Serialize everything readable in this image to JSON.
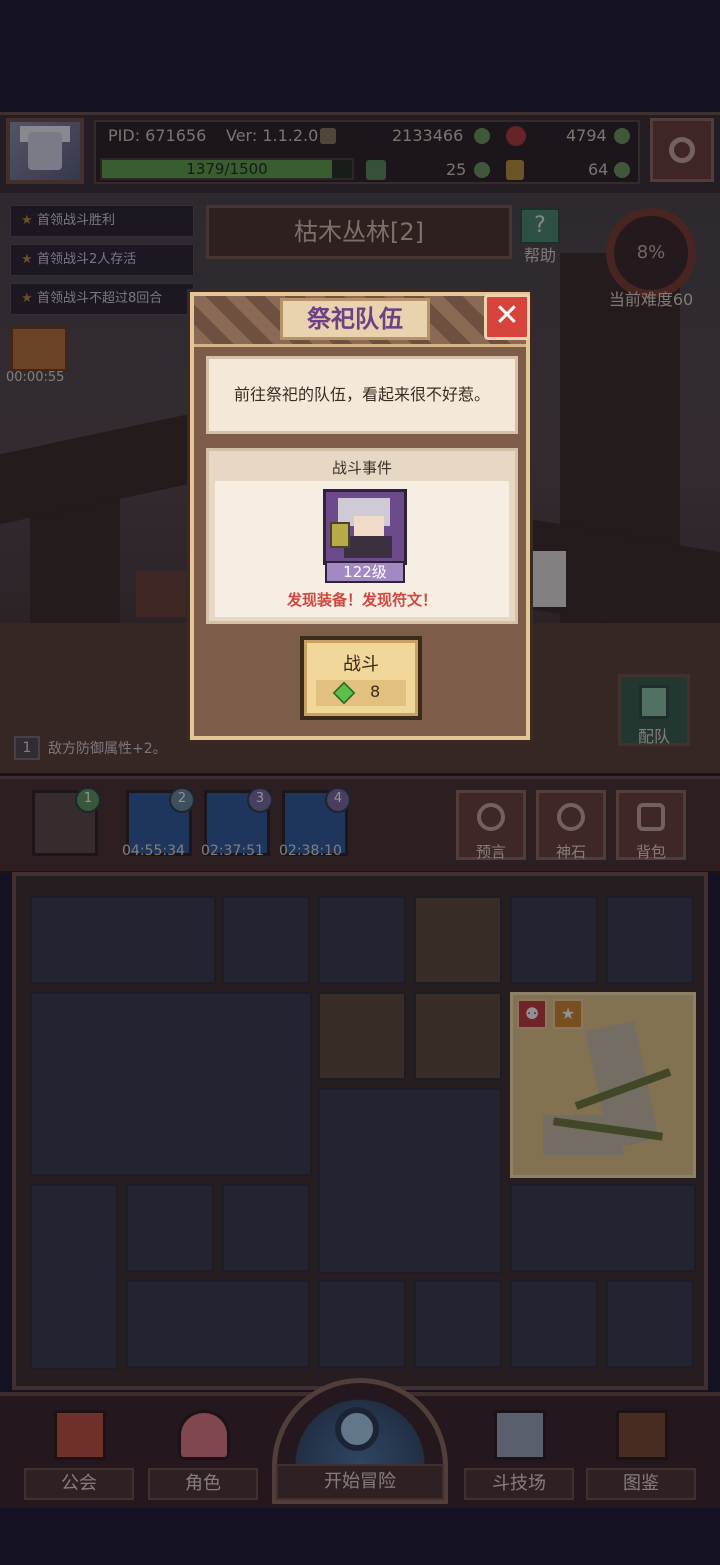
{
  "player": {
    "pid": "PID: 671656",
    "version": "Ver: 1.1.2.0",
    "exp_text": "1379/1500",
    "exp_fraction": 0.92,
    "currency": {
      "gold": "2133466",
      "red_gem": "4794",
      "clover": "25",
      "key": "64"
    }
  },
  "stage": {
    "title": "枯木丛林[2]",
    "help_label": "帮助",
    "difficulty_percent": "8%",
    "difficulty_label": "当前难度60",
    "chest_timer": "00:00:55",
    "quests": [
      "首领战斗胜利",
      "首领战斗2人存活",
      "首领战斗不超过8回合"
    ],
    "buff": {
      "badge": "1",
      "text": "敌方防御属性+2。"
    },
    "team_label": "配队"
  },
  "modal": {
    "title": "祭祀队伍",
    "close_icon": "✕",
    "description": "前往祭祀的队伍，看起来很不好惹。",
    "event_label": "战斗事件",
    "enemy_level": "122级",
    "reward_text": "发现装备！发现符文！",
    "fight_label": "战斗",
    "fight_cost": "8"
  },
  "toolbar": {
    "slots": [
      {
        "badge": "1",
        "timer": ""
      },
      {
        "badge": "2",
        "timer": "04:55:34"
      },
      {
        "badge": "3",
        "timer": "02:37:51"
      },
      {
        "badge": "4",
        "timer": "02:38:10"
      }
    ],
    "buttons": [
      "预言",
      "神石",
      "背包"
    ]
  },
  "bottom_nav": {
    "guild": "公会",
    "character": "角色",
    "start": "开始冒险",
    "arena": "斗技场",
    "codex": "图鉴"
  },
  "colors": {
    "background": "#1c1a30",
    "modal_title_text": "#6d3f84",
    "reward_red": "#d2473f",
    "gem_green": "#5dbf4c"
  }
}
